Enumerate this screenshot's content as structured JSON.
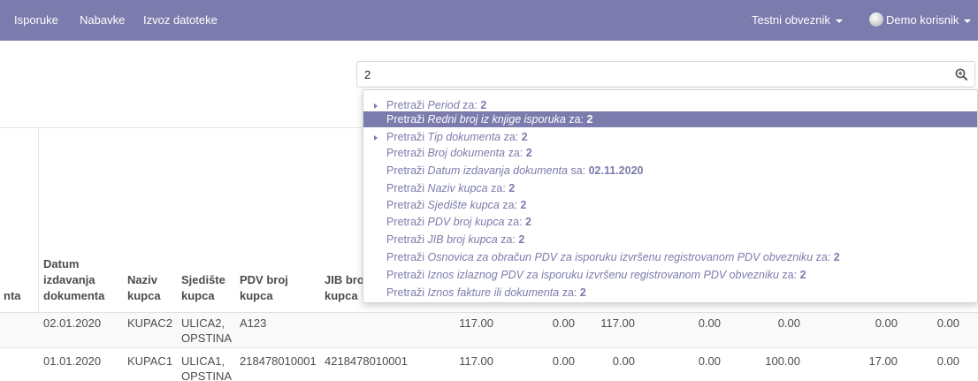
{
  "nav": {
    "menu": [
      "Isporuke",
      "Nabavke",
      "Izvoz datoteke"
    ],
    "company": "Testni obveznik",
    "user": "Demo korisnik"
  },
  "search": {
    "value": "2"
  },
  "dropdown": {
    "items": [
      {
        "prefix": "Pretraži ",
        "field": "Period",
        "suffix": " za: ",
        "value": "2",
        "expandable": true,
        "active": false
      },
      {
        "prefix": "Pretraži ",
        "field": "Redni broj iz knjige isporuka",
        "suffix": " za: ",
        "value": "2",
        "expandable": false,
        "active": true
      },
      {
        "prefix": "Pretraži ",
        "field": "Tip dokumenta",
        "suffix": " za: ",
        "value": "2",
        "expandable": true,
        "active": false
      },
      {
        "prefix": "Pretraži ",
        "field": "Broj dokumenta",
        "suffix": " za: ",
        "value": "2",
        "expandable": false,
        "active": false
      },
      {
        "prefix": "Pretraži ",
        "field": "Datum izdavanja dokumenta",
        "suffix": " sa: ",
        "value": "02.11.2020",
        "expandable": false,
        "active": false
      },
      {
        "prefix": "Pretraži ",
        "field": "Naziv kupca",
        "suffix": " za: ",
        "value": "2",
        "expandable": false,
        "active": false
      },
      {
        "prefix": "Pretraži ",
        "field": "Sjedište kupca",
        "suffix": " za: ",
        "value": "2",
        "expandable": false,
        "active": false
      },
      {
        "prefix": "Pretraži ",
        "field": "PDV broj kupca",
        "suffix": " za: ",
        "value": "2",
        "expandable": false,
        "active": false
      },
      {
        "prefix": "Pretraži ",
        "field": "JIB broj kupca",
        "suffix": " za: ",
        "value": "2",
        "expandable": false,
        "active": false
      },
      {
        "prefix": "Pretraži ",
        "field": "Osnovica za obračun PDV za isporuku izvršenu registrovanom PDV obvezniku",
        "suffix": " za: ",
        "value": "2",
        "expandable": false,
        "active": false
      },
      {
        "prefix": "Pretraži ",
        "field": "Iznos izlaznog PDV za isporuku izvršenu registrovanom PDV obvezniku",
        "suffix": " za: ",
        "value": "2",
        "expandable": false,
        "active": false
      },
      {
        "prefix": "Pretraži ",
        "field": "Iznos fakture ili dokumenta",
        "suffix": " za: ",
        "value": "2",
        "expandable": false,
        "active": false
      }
    ]
  },
  "table": {
    "headers": {
      "partial": "nta",
      "datum": [
        "Datum",
        "izdavanja",
        "dokumenta"
      ],
      "naziv": [
        "Naziv",
        "kupca"
      ],
      "sjediste": [
        "Sjedište",
        "kupca"
      ],
      "pdv": [
        "PDV broj",
        "kupca"
      ],
      "jib": [
        "JIB bro",
        "kupca"
      ]
    },
    "rows": [
      {
        "datum": "02.01.2020",
        "naziv": "KUPAC2",
        "sjediste": "ULICA2, OPSTINA",
        "pdv": "A123",
        "jib": "",
        "v1": "117.00",
        "v2": "0.00",
        "v3": "117.00",
        "v4": "0.00",
        "v5": "0.00",
        "v6": "0.00",
        "v7": "0.00"
      },
      {
        "datum": "01.01.2020",
        "naziv": "KUPAC1",
        "sjediste": "ULICA1, OPSTINA",
        "pdv": "218478010001",
        "jib": "4218478010001",
        "v1": "117.00",
        "v2": "0.00",
        "v3": "0.00",
        "v4": "0.00",
        "v5": "100.00",
        "v6": "17.00",
        "v7": "0.00"
      }
    ]
  },
  "colors": {
    "navbar": "#7c7bad",
    "accent": "#7c7bad"
  },
  "icons": {
    "search": "zoom-in-icon",
    "user": "avatar-icon",
    "caret": "caret-down-icon"
  }
}
